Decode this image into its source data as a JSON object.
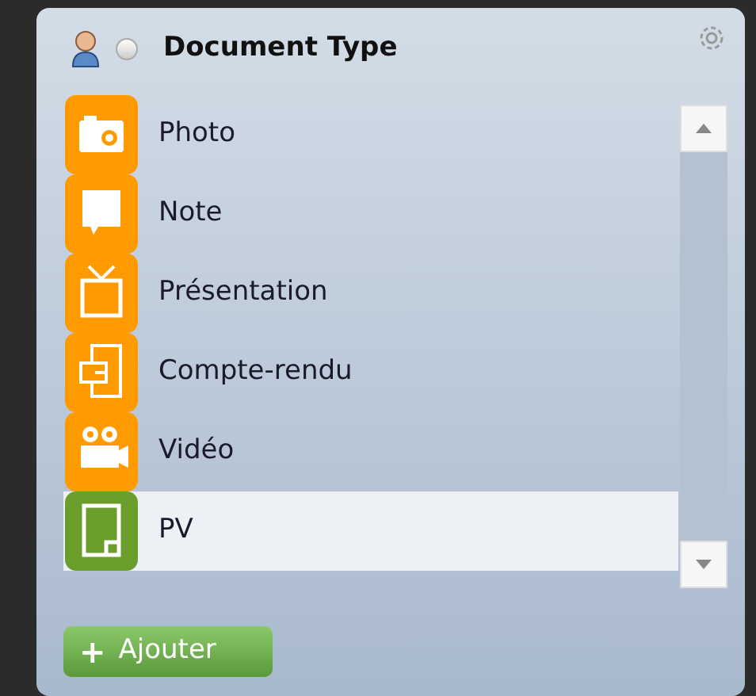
{
  "panel": {
    "title": "Document Type",
    "radio_checked": false
  },
  "items": [
    {
      "label": "Photo",
      "kind": "camera",
      "selected": false
    },
    {
      "label": "Note",
      "kind": "speech",
      "selected": false
    },
    {
      "label": "Présentation",
      "kind": "tv",
      "selected": false
    },
    {
      "label": "Compte-rendu",
      "kind": "report",
      "selected": false
    },
    {
      "label": "Vidéo",
      "kind": "projector",
      "selected": false
    },
    {
      "label": "PV",
      "kind": "page",
      "selected": true
    }
  ],
  "add_button": {
    "icon": "+",
    "label": "Ajouter"
  }
}
